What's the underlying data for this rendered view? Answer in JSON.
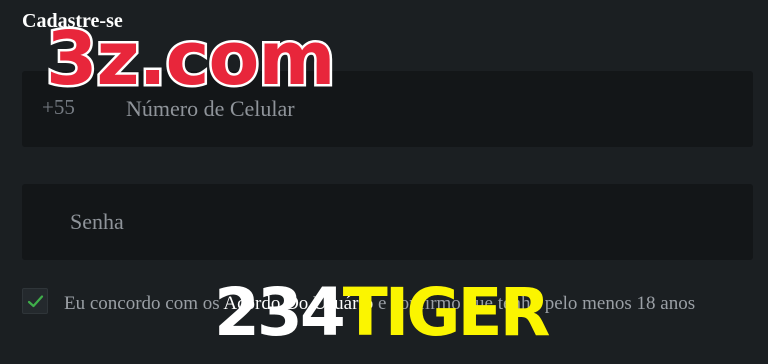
{
  "header": {
    "title": "Cadastre-se"
  },
  "phone": {
    "country_code": "+55",
    "placeholder": "Número de Celular"
  },
  "password": {
    "placeholder": "Senha"
  },
  "terms": {
    "checked": true,
    "before_link": "Eu concordo com os ",
    "link": "Acordo Do Usuário",
    "after_link": " e confirmo que tenho pelo menos 18 anos"
  },
  "watermark": {
    "top": "3z.com",
    "bottom_number": "234",
    "bottom_word": "TIGER"
  },
  "colors": {
    "background": "#1b1f22",
    "field_background": "#131618",
    "check_green": "#3fae4a",
    "watermark_red": "#e8263b",
    "watermark_yellow": "#fbf500"
  }
}
